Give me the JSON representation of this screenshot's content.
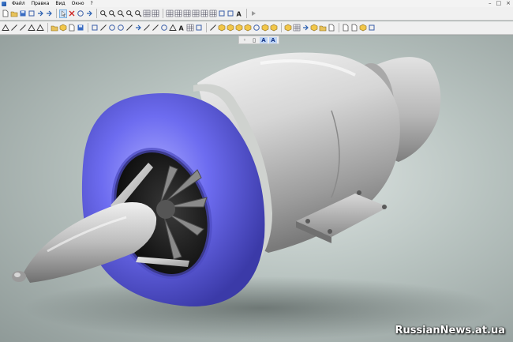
{
  "menubar": {
    "items": [
      "Файл",
      "Правка",
      "Вид",
      "Окно",
      "?"
    ],
    "controls": [
      "–",
      "□",
      "×"
    ]
  },
  "toolbar_top": {
    "buttons": [
      "new-document-icon",
      "open-folder-icon",
      "save-icon",
      "print-icon",
      "undo-icon",
      "redo-icon",
      "select-pointer-icon",
      "delete-icon",
      "rotate-view-icon",
      "pan-view-icon",
      "zoom-icon",
      "zoom-in-icon",
      "zoom-out-icon",
      "zoom-fit-icon",
      "zoom-window-icon",
      "grid-icon",
      "layers-icon",
      "properties-icon",
      "window-icon",
      "tile-windows-icon",
      "table-icon",
      "variables-icon",
      "parameters-icon",
      "macro-icon",
      "image-icon",
      "text-icon",
      "play-icon"
    ]
  },
  "toolbar_bottom": {
    "buttons": [
      "sketch-icon",
      "dimension-icon",
      "measure-icon",
      "attribute-icon",
      "constraint-icon",
      "library-icon",
      "model-tree-icon",
      "report-icon",
      "export-icon",
      "rectangle-icon",
      "line-icon",
      "arc-icon",
      "circle-icon",
      "curve-icon",
      "offset-icon",
      "polyline-icon",
      "spline-icon",
      "fillet-icon",
      "chamfer-icon",
      "text-tool-icon",
      "hatch-icon",
      "insert-image-icon",
      "axis-icon",
      "face-icon",
      "solid-icon",
      "shell-icon",
      "extrude-icon",
      "revolve-icon",
      "loft-icon",
      "sweep-icon",
      "boolean-icon",
      "pattern-icon",
      "mirror-icon",
      "section-icon",
      "assembly-icon",
      "part-icon",
      "bom-icon",
      "drawing-view-icon",
      "render-icon",
      "options-icon"
    ]
  },
  "text_style_bar": {
    "buttons": [
      "A",
      "A"
    ]
  },
  "watermark": "RussianNews.at.ua",
  "colors": {
    "intake_blue": "#6f6ef2",
    "metal_light": "#e8e8e8",
    "metal_mid": "#b3b3b3",
    "metal_dark": "#7a7a7a"
  }
}
